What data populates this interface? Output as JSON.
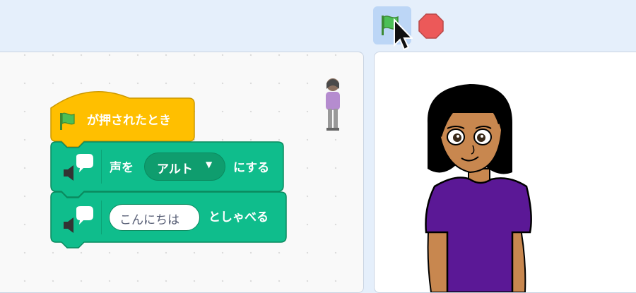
{
  "controls": {
    "green_flag_icon": "green-flag",
    "stop_icon": "stop-sign"
  },
  "script": {
    "hat": {
      "icon": "green-flag",
      "label": "が押されたとき"
    },
    "set_voice": {
      "icon": "text2speech-icon",
      "prefix": "声を",
      "value": "アルト",
      "suffix": "にする"
    },
    "speak": {
      "icon": "text2speech-icon",
      "value": "こんにちは",
      "suffix": "としゃべる"
    }
  },
  "colors": {
    "events": "#ffbf00",
    "extension": "#0fbd8c",
    "accent": "#4c97ff"
  }
}
